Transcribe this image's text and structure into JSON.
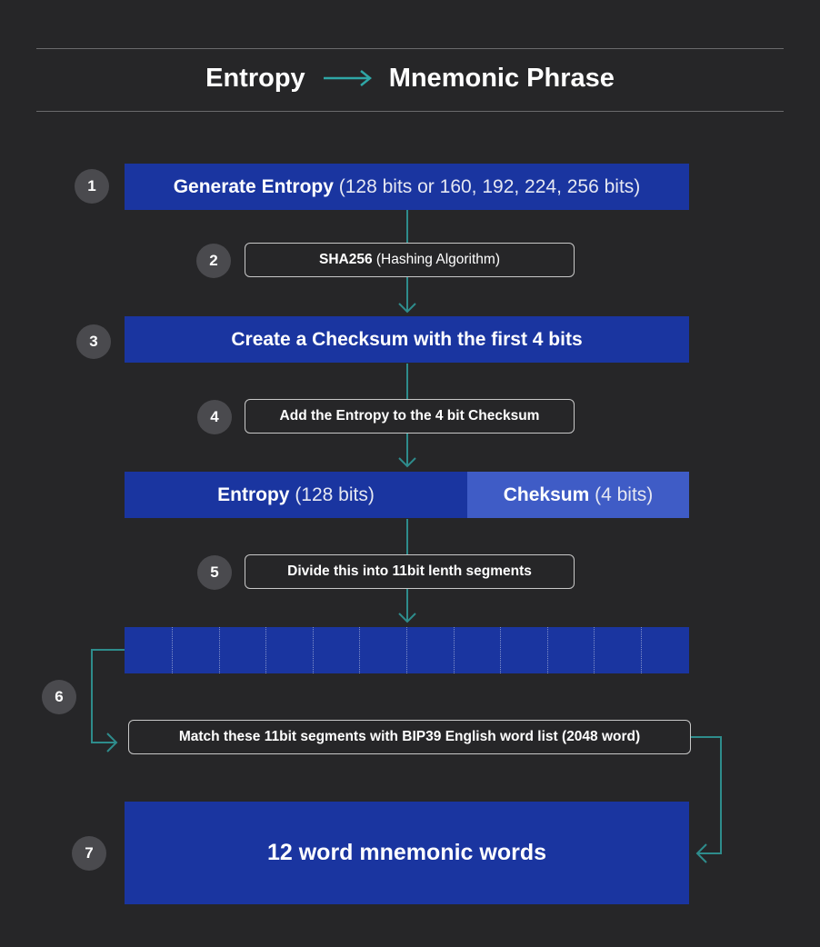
{
  "header": {
    "title_left": "Entropy",
    "title_right": "Mnemonic Phrase"
  },
  "steps": [
    {
      "number": "1",
      "bold": "Generate Entropy",
      "light": "(128 bits or 160, 192, 224, 256 bits)"
    },
    {
      "number": "2",
      "bold": "SHA256",
      "light": "(Hashing Algorithm)"
    },
    {
      "number": "3",
      "bold": "Create a Checksum with the first 4 bits"
    },
    {
      "number": "4",
      "bold": "Add the Entropy to the 4 bit Checksum"
    },
    {
      "number": "5",
      "bold": "Divide this into 11bit lenth segments"
    },
    {
      "number": "6",
      "bold": "Match these 11bit segments with BIP39 English word list (2048 word)"
    },
    {
      "number": "7",
      "bold": "12 word mnemonic words"
    }
  ],
  "combined_bar": {
    "entropy_bold": "Entropy",
    "entropy_light": "(128 bits)",
    "checksum_bold": "Cheksum",
    "checksum_light": "(4 bits)"
  },
  "segments_count": 12,
  "colors": {
    "background": "#262628",
    "primary_box": "#1a35a0",
    "checksum_box": "#3f5cc6",
    "connector": "#2e8c8c",
    "badge": "#4a4a4e"
  }
}
